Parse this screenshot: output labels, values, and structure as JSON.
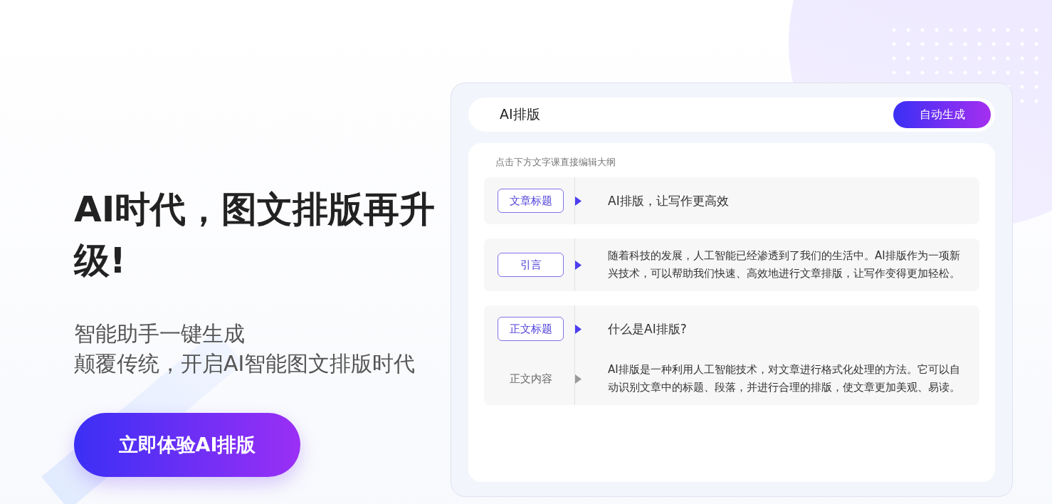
{
  "hero": {
    "headline": "AI时代，图文排版再升级!",
    "subtitle_lines": [
      "智能助手一键生成",
      "颠覆传统，开启AI智能图文排版时代"
    ],
    "cta": "立即体验AI排版"
  },
  "panel": {
    "title": "AI排版",
    "generate_button": "自动生成",
    "hint": "点击下方文字课直接编辑大纲",
    "groups": [
      {
        "rows": [
          {
            "kind": "tag",
            "label": "文章标题",
            "text": "AI排版，让写作更高效"
          }
        ]
      },
      {
        "rows": [
          {
            "kind": "tag",
            "label": "引言",
            "text": "随着科技的发展，人工智能已经渗透到了我们的生活中。AI排版作为一项新兴技术，可以帮助我们快速、高效地进行文章排版，让写作变得更加轻松。"
          }
        ]
      },
      {
        "rows": [
          {
            "kind": "tag",
            "label": "正文标题",
            "text": "什么是AI排版?"
          },
          {
            "kind": "plain",
            "label": "正文内容",
            "text": "AI排版是一种利用人工智能技术，对文章进行格式化处理的方法。它可以自动识别文章中的标题、段落，并进行合理的排版，使文章更加美观、易读。"
          }
        ]
      }
    ]
  }
}
